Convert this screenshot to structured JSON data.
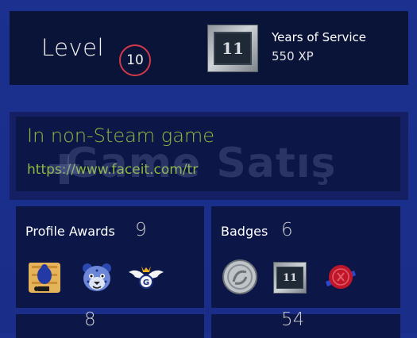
{
  "level": {
    "label": "Level",
    "value": "10"
  },
  "service": {
    "badge_number": "11",
    "title": "Years of Service",
    "xp": "550 XP"
  },
  "status": {
    "game": "In non-Steam game",
    "link": "https://www.faceit.com/tr"
  },
  "watermark": {
    "text": "Game Satış"
  },
  "awards": {
    "title": "Profile Awards",
    "count": "9",
    "icons": [
      "scroll-figure-icon",
      "leopard-face-icon",
      "winged-emblem-icon"
    ]
  },
  "badges": {
    "title": "Badges",
    "count": "6",
    "icons": [
      "silver-coin-icon",
      "years-of-service-11-icon",
      "wax-seal-icon"
    ],
    "service_number": "11"
  },
  "bottom": {
    "left_count": "8",
    "right_count": "54"
  },
  "colors": {
    "background": "#1b308f",
    "panel": "#0c1748",
    "status_green": "#90ba3c",
    "level_ring": "#d23a4a"
  }
}
